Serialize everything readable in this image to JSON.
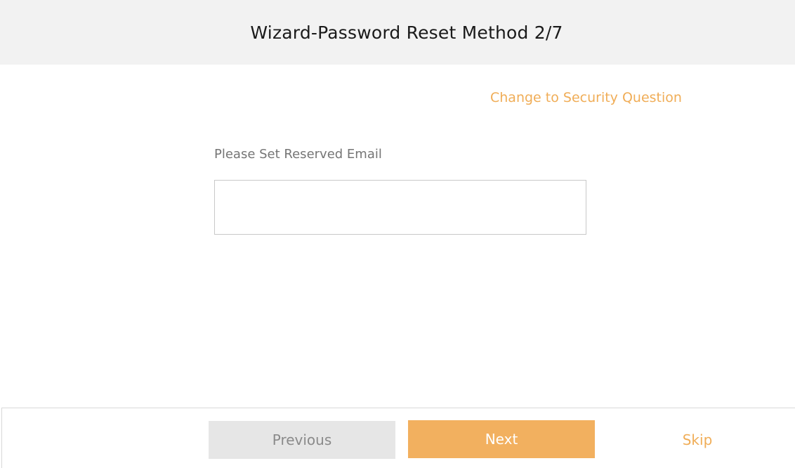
{
  "header": {
    "title": "Wizard-Password Reset Method 2/7"
  },
  "main": {
    "change_link": "Change to Security Question",
    "email_label": "Please Set Reserved Email",
    "email_value": "",
    "email_placeholder": ""
  },
  "footer": {
    "previous_label": "Previous",
    "next_label": "Next",
    "skip_label": "Skip"
  },
  "colors": {
    "accent": "#f2b05f",
    "link": "#f0ad57",
    "header_bg": "#f2f2f2",
    "disabled_button_bg": "#e6e6e6"
  }
}
